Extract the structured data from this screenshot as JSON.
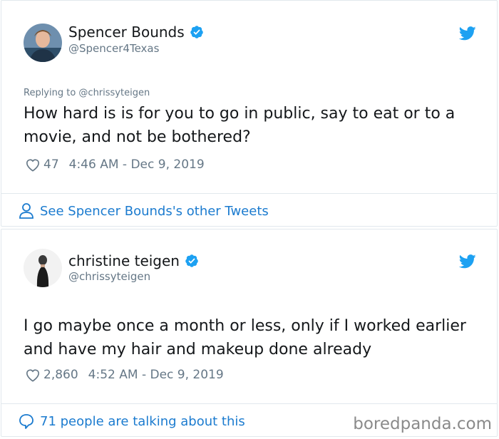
{
  "tweet1": {
    "author_name": "Spencer Bounds",
    "author_handle": "@Spencer4Texas",
    "replying_to": "Replying to @chrissyteigen",
    "text": "How hard is is for you to go in public, say to eat or to a movie, and not be bothered?",
    "likes": "47",
    "timestamp": "4:46 AM - Dec 9, 2019",
    "footer_link": "See Spencer Bounds's other Tweets",
    "avatar_icon": "person-avatar-icon",
    "verified_icon": "verified-badge-icon",
    "brand_icon": "twitter-bird-icon"
  },
  "tweet2": {
    "author_name": "christine teigen",
    "author_handle": "@chrissyteigen",
    "text": "I go maybe once a month or less, only if I worked earlier and have my hair and makeup done already",
    "likes": "2,860",
    "timestamp": "4:52 AM - Dec 9, 2019",
    "footer_link": "71 people are talking about this",
    "avatar_icon": "person-avatar-icon",
    "verified_icon": "verified-badge-icon",
    "brand_icon": "twitter-bird-icon"
  },
  "watermark": "boredpanda.com",
  "colors": {
    "twitter_blue": "#1da1f2",
    "link_blue": "#1b7bcf",
    "secondary_text": "#657786",
    "border": "#e1e8ed"
  }
}
